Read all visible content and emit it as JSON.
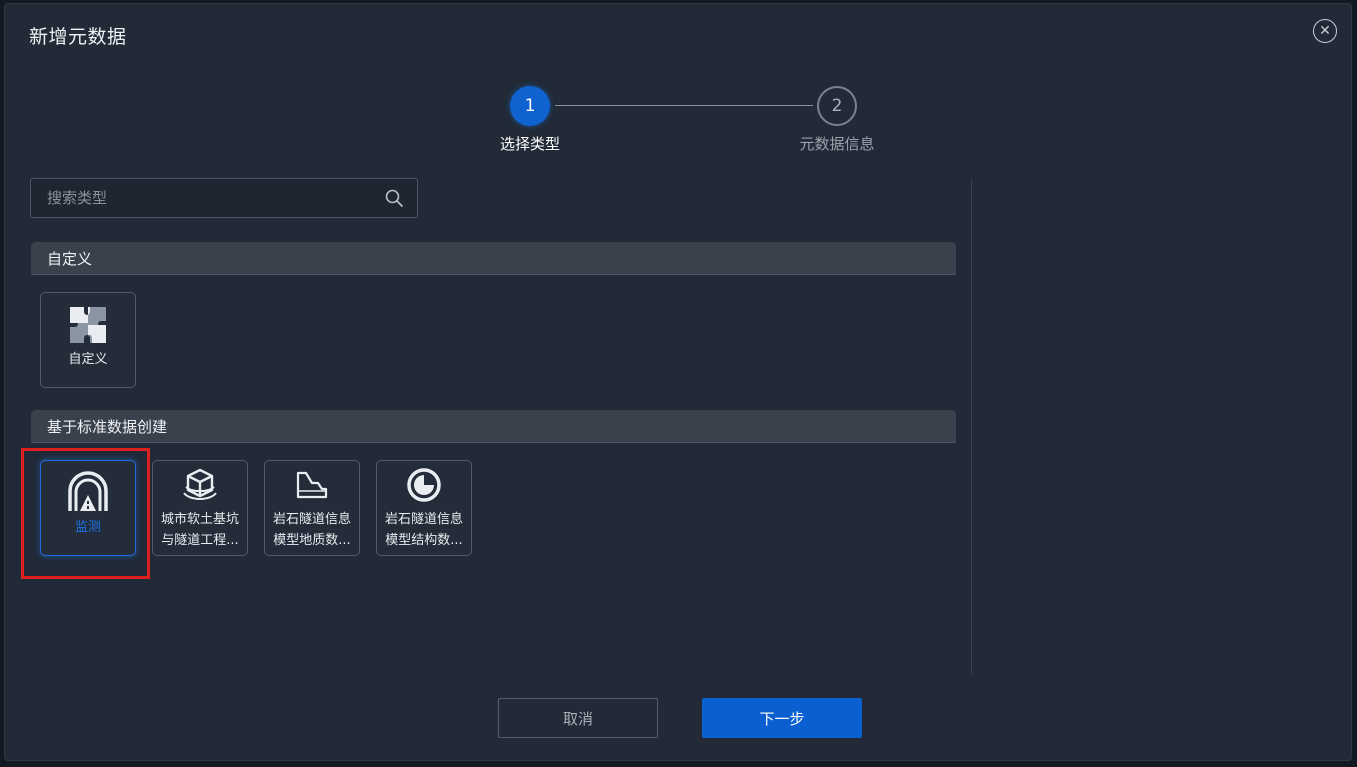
{
  "dialog": {
    "title": "新增元数据",
    "close_icon": "close-circle-icon"
  },
  "steps": [
    {
      "number": "1",
      "label": "选择类型",
      "state": "active"
    },
    {
      "number": "2",
      "label": "元数据信息",
      "state": "pending"
    }
  ],
  "search": {
    "placeholder": "搜索类型",
    "value": "",
    "icon": "search-icon"
  },
  "sections": {
    "custom": {
      "title": "自定义",
      "items": [
        {
          "label": "自定义",
          "icon": "puzzle-icon"
        }
      ]
    },
    "standard": {
      "title": "基于标准数据创建",
      "items": [
        {
          "label": "监测",
          "icon": "tunnel-icon",
          "selected": true
        },
        {
          "label": "城市软土基坑与隧道工程...",
          "line1": "城市软土基坑",
          "line2": "与隧道工程...",
          "icon": "cube-icon"
        },
        {
          "label": "岩石隧道信息模型地质数...",
          "line1": "岩石隧道信息",
          "line2": "模型地质数...",
          "icon": "terrain-icon"
        },
        {
          "label": "岩石隧道信息模型结构数...",
          "line1": "岩石隧道信息",
          "line2": "模型结构数...",
          "icon": "pie-chart-icon"
        }
      ]
    }
  },
  "footer": {
    "cancel_label": "取消",
    "next_label": "下一步"
  },
  "colors": {
    "accent": "#0b5fd0",
    "highlight": "#e0201f",
    "dialog_bg": "#212a36"
  }
}
